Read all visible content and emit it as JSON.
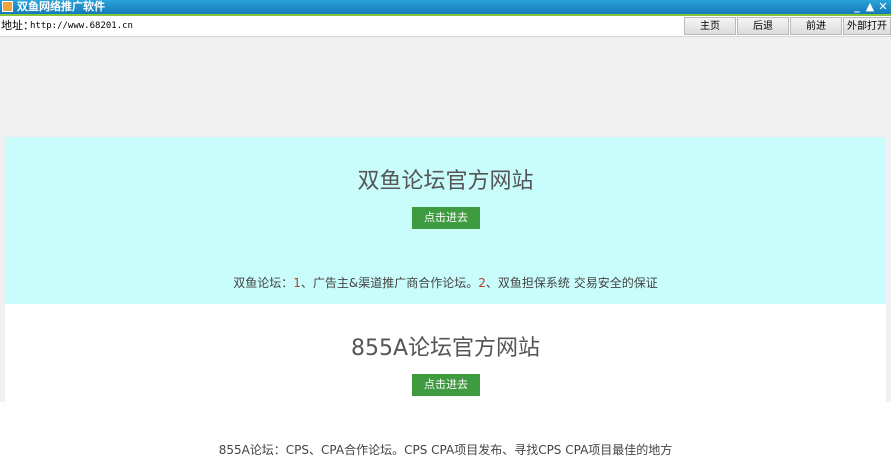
{
  "window": {
    "title": "双鱼网络推广软件",
    "controls": {
      "minimize": "_",
      "restore": "▲",
      "close": "✕"
    }
  },
  "toolbar": {
    "address_label": "地址：",
    "address_value": "http://www.68201.cn",
    "buttons": {
      "home": "主页",
      "back": "后退",
      "forward": "前进",
      "external": "外部打开"
    }
  },
  "sites": [
    {
      "title": "双鱼论坛官方网站",
      "button": "点击进去",
      "desc_prefix": "双鱼论坛：",
      "n1": "1",
      "part1": "、广告主&渠道推广商合作论坛。",
      "n2": "2",
      "part2": "、双鱼担保系统 交易安全的保证"
    },
    {
      "title": "855A论坛官方网站",
      "button": "点击进去",
      "desc": "855A论坛：CPS、CPA合作论坛。CPS CPA项目发布、寻找CPS CPA项目最佳的地方"
    }
  ],
  "colors": {
    "titlebar": "#1b8ecb",
    "accent_line": "#84c53b",
    "section1_bg": "#c9fdfb",
    "enter_button": "#3f9b3f",
    "highlight_number": "#c0392b"
  }
}
